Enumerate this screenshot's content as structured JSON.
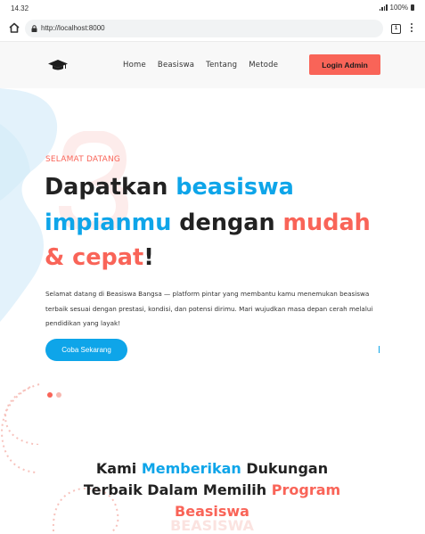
{
  "status_bar": {
    "time": "14.32",
    "battery": "100%"
  },
  "browser": {
    "url": "http://localhost:8000",
    "tab_count": "1"
  },
  "navbar": {
    "links": [
      "Home",
      "Beasiswa",
      "Tentang",
      "Metode"
    ],
    "login_label": "Login Admin"
  },
  "hero": {
    "eyebrow": "SELAMAT DATANG",
    "headline": {
      "w1": "Dapatkan ",
      "w2": "beasiswa",
      "w3": "impianmu",
      "w4": " dengan ",
      "w5": "mudah",
      "w6": "& cepat",
      "w7": "!"
    },
    "lead": "Selamat datang di Beasiswa Bangsa — platform pintar yang membantu kamu menemukan beasiswa terbaik sesuai dengan prestasi, kondisi, dan potensi dirimu. Mari wujudkan masa depan cerah melalui pendidikan yang layak!",
    "cta_label": "Coba Sekarang",
    "carousel": {
      "slides": 2,
      "active": 1
    }
  },
  "section": {
    "t1": "Kami ",
    "t2": "Memberikan",
    "t3": " Dukungan Terbaik Dalam Memilih ",
    "t4": "Program Beasiswa",
    "ghost": "BEASISWA"
  },
  "colors": {
    "accent_blue": "#0ea5e9",
    "accent_coral": "#f96458",
    "heading": "#222222"
  },
  "icons": [
    "home-icon",
    "lock-icon",
    "tabs-icon",
    "more-vert-icon",
    "graduation-cap-icon",
    "signal-icon",
    "battery-icon"
  ]
}
